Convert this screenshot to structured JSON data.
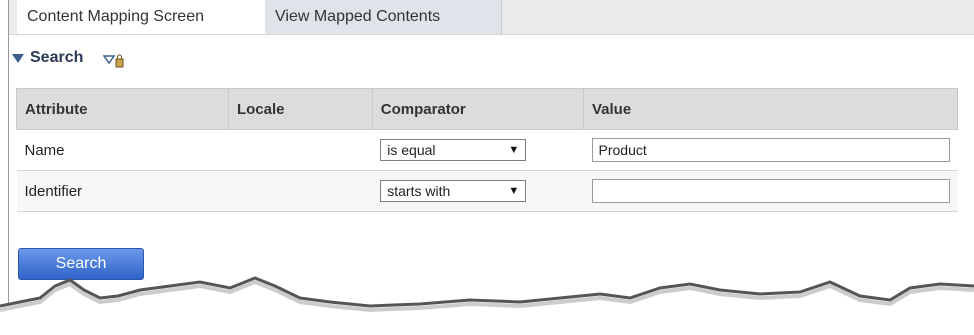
{
  "tabs": {
    "active": "Content Mapping Screen",
    "inactive": "View Mapped Contents"
  },
  "search_panel": {
    "title": "Search",
    "icons": [
      "collapse-triangle-icon",
      "filter-lock-icon"
    ]
  },
  "table": {
    "headers": [
      "Attribute",
      "Locale",
      "Comparator",
      "Value"
    ],
    "rows": [
      {
        "attribute": "Name",
        "locale": "",
        "comparator": "is equal",
        "value": "Product"
      },
      {
        "attribute": "Identifier",
        "locale": "",
        "comparator": "starts with",
        "value": ""
      }
    ]
  },
  "actions": {
    "search_label": "Search"
  },
  "colors": {
    "button": "#2f63c9",
    "header_bg": "#dcdcdc",
    "tabbar_bg": "#eaeaea"
  }
}
